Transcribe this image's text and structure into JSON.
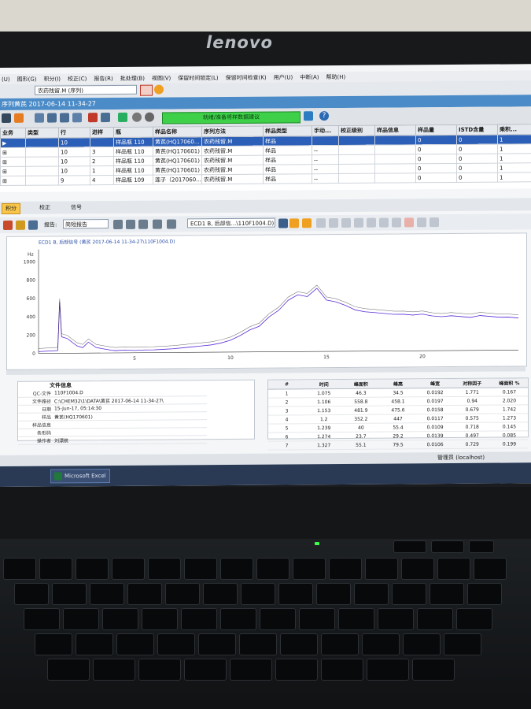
{
  "device": {
    "brand": "lenovo"
  },
  "app": {
    "menu": [
      "(U)",
      "图形(G)",
      "积分(I)",
      "校正(C)",
      "报告(R)",
      "批处理(B)",
      "视图(V)",
      "保留时间锁定(L)",
      "保留时间检查(K)",
      "用户(U)",
      "中断(A)",
      "帮助(H)"
    ],
    "method_value": "农药残留.M (序列)",
    "title": "序列黄芪 2017-06-14 11-34-27",
    "status_green": "就绪/准备将样数据建议",
    "seq_headers": [
      "业务",
      "类型",
      "行",
      "进样",
      "瓶",
      "样品名称",
      "序列方法",
      "样品类型",
      "手动...",
      "校正级别",
      "样品信息",
      "样品量",
      "ISTD含量",
      "乘积..."
    ],
    "seq_rows": [
      [
        "▶",
        "",
        "10",
        "",
        "样品瓶 110",
        "黄芪(HQ17060...",
        "农药残留.M",
        "样品",
        "",
        "",
        "",
        "0",
        "0",
        "1"
      ],
      [
        "⊞",
        "",
        "10",
        "3",
        "样品瓶 110",
        "黄芪(HQ170601)",
        "农药残留.M",
        "样品",
        "--",
        "",
        "",
        "0",
        "0",
        "1"
      ],
      [
        "⊞",
        "",
        "10",
        "2",
        "样品瓶 110",
        "黄芪(HQ170601)",
        "农药残留.M",
        "样品",
        "--",
        "",
        "",
        "0",
        "0",
        "1"
      ],
      [
        "⊞",
        "",
        "10",
        "1",
        "样品瓶 110",
        "黄芪(HQ170601)",
        "农药残留.M",
        "样品",
        "--",
        "",
        "",
        "0",
        "0",
        "1"
      ],
      [
        "⊞",
        "",
        "9",
        "4",
        "样品瓶 109",
        "莲子（2017060...",
        "农药残留.M",
        "样品",
        "--",
        "",
        "",
        "0",
        "0",
        "1"
      ]
    ],
    "tabs": [
      "积分",
      "校正",
      "信号"
    ],
    "report_label": "报告:",
    "report_value": "简短报告",
    "signal_select": "ECD1 B, 后部信...\\110F1004.D)",
    "chart_title": "ECD1 B, 后部信号 (黄芪 2017-06-14 11-34-27\\110F1004.D)",
    "yunit": "Hz",
    "file_info_title": "文件信息",
    "file_info": [
      [
        "QC-文件",
        "110F1004.D"
      ],
      [
        "文件路径",
        "C:\\CHEM32\\1\\DATA\\黄芪 2017-06-14 11-34-27\\"
      ],
      [
        "日期",
        "15-Jun-17, 05:14:30"
      ],
      [
        "样品",
        "黄芪(HQ170601)"
      ],
      [
        "样品信息",
        ""
      ],
      [
        "条形码",
        ""
      ],
      [
        "操作者",
        "刘漂航"
      ]
    ],
    "peak_headers": [
      "#",
      "时间",
      "峰面积",
      "峰高",
      "峰宽",
      "对称因子",
      "峰面积 %"
    ],
    "peaks": [
      [
        "1",
        "1.075",
        "46.3",
        "34.5",
        "0.0192",
        "1.771",
        "0.167"
      ],
      [
        "2",
        "1.106",
        "558.8",
        "458.1",
        "0.0197",
        "0.94",
        "2.020"
      ],
      [
        "3",
        "1.153",
        "481.9",
        "475.6",
        "0.0158",
        "0.679",
        "1.742"
      ],
      [
        "4",
        "1.2",
        "352.2",
        "447",
        "0.0117",
        "0.575",
        "1.273"
      ],
      [
        "5",
        "1.239",
        "40",
        "55.4",
        "0.0109",
        "0.718",
        "0.145"
      ],
      [
        "6",
        "1.274",
        "23.7",
        "29.2",
        "0.0139",
        "0.497",
        "0.085"
      ],
      [
        "7",
        "1.327",
        "55.1",
        "79.5",
        "0.0106",
        "0.729",
        "0.199"
      ]
    ],
    "status_user": "管理员 (localhost)",
    "taskbar_excel": "Microsoft Excel"
  },
  "chart_data": {
    "type": "line",
    "title": "ECD1 B, 后部信号 (黄芪 2017-06-14 11-34-27\\110F1004.D)",
    "ylabel": "Hz",
    "xlim": [
      0,
      25
    ],
    "ylim": [
      0,
      1100
    ],
    "yticks": [
      0,
      200,
      400,
      600,
      800,
      1000
    ],
    "xticks": [
      5,
      10,
      15,
      20
    ],
    "series": [
      {
        "x": [
          0,
          1,
          1.1,
          1.2,
          1.5,
          2,
          2.3,
          2.6,
          3,
          3.5,
          3.8,
          4,
          4.5,
          5,
          5.5,
          6,
          6.5,
          7,
          7.5,
          8,
          8.5,
          9,
          9.5,
          10,
          10.5,
          11,
          11.5,
          12,
          12.5,
          13,
          13.5,
          14,
          14.5,
          15,
          15.5,
          16,
          16.5,
          17,
          17.5,
          18,
          18.5,
          19,
          19.5,
          20,
          20.5,
          21,
          21.5,
          22,
          22.5,
          23,
          23.5,
          24,
          24.5,
          25
        ],
        "y": [
          20,
          30,
          560,
          180,
          160,
          80,
          60,
          120,
          60,
          40,
          30,
          25,
          30,
          25,
          30,
          30,
          35,
          40,
          50,
          60,
          70,
          80,
          100,
          130,
          180,
          240,
          280,
          380,
          450,
          560,
          620,
          600,
          690,
          560,
          540,
          500,
          450,
          430,
          420,
          410,
          400,
          400,
          390,
          400,
          380,
          370,
          380,
          370,
          360,
          380,
          370,
          360,
          360,
          350
        ]
      }
    ]
  }
}
